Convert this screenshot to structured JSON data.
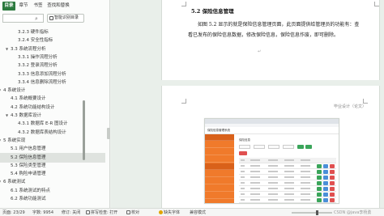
{
  "nav": {
    "tabs": [
      {
        "label": "目录",
        "active": true
      },
      {
        "label": "章节",
        "active": false
      },
      {
        "label": "书签",
        "active": false
      },
      {
        "label": "查找和替换",
        "active": false
      }
    ],
    "search_placeholder": "",
    "smart_toc_label": "智能识别目录",
    "toc": [
      {
        "label": "3.2.3 硬件指标",
        "level": 3,
        "expanded": null,
        "selected": false
      },
      {
        "label": "3.2.4 安全性指标",
        "level": 3,
        "expanded": null,
        "selected": false
      },
      {
        "label": "3.3 系统流程分析",
        "level": 2,
        "expanded": true,
        "selected": false
      },
      {
        "label": "3.3.1 操作流程分析",
        "level": 3,
        "expanded": null,
        "selected": false
      },
      {
        "label": "3.3.2 登录流程分析",
        "level": 3,
        "expanded": null,
        "selected": false
      },
      {
        "label": "3.3.3 信息添加流程分析",
        "level": 3,
        "expanded": null,
        "selected": false
      },
      {
        "label": "3.3.4 信息删除流程分析",
        "level": 3,
        "expanded": null,
        "selected": false
      },
      {
        "label": "4 系统设计",
        "level": 1,
        "expanded": true,
        "selected": false
      },
      {
        "label": "4.1 系统概要设计",
        "level": 2,
        "expanded": null,
        "selected": false
      },
      {
        "label": "4.2 系统功能结构设计",
        "level": 2,
        "expanded": null,
        "selected": false
      },
      {
        "label": "4.3 数据库设计",
        "level": 2,
        "expanded": true,
        "selected": false
      },
      {
        "label": "4.3.1 数据库 E-R 图设计",
        "level": 3,
        "expanded": null,
        "selected": false
      },
      {
        "label": "4.3.2 数据库表结构设计",
        "level": 3,
        "expanded": null,
        "selected": false
      },
      {
        "label": "5 系统实现",
        "level": 1,
        "expanded": true,
        "selected": false
      },
      {
        "label": "5.1 用户信息管理",
        "level": 2,
        "expanded": null,
        "selected": false
      },
      {
        "label": "5.2 保险信息管理",
        "level": 2,
        "expanded": null,
        "selected": true
      },
      {
        "label": "5.3 保险类型管理",
        "level": 2,
        "expanded": null,
        "selected": false
      },
      {
        "label": "5.4 购险申请管理",
        "level": 2,
        "expanded": null,
        "selected": false
      },
      {
        "label": "6 系统测试",
        "level": 1,
        "expanded": true,
        "selected": false
      },
      {
        "label": "6.1 系统测试的特点",
        "level": 2,
        "expanded": null,
        "selected": false
      },
      {
        "label": "6.2 系统功能测试",
        "level": 2,
        "expanded": null,
        "selected": false
      }
    ]
  },
  "document": {
    "section_heading": "5.2 保险信息管理",
    "paragraph_lines": [
      "如图 5.2 显示的就是保险信息管理页面，此页面提供给管理员的功能有：查",
      "看已发布的保险信息数据，修改保险信息，保险信息作废，即可删除。"
    ],
    "footer_label": "毕业设计（论文）",
    "figure": {
      "title": "保险信息管理系统",
      "heading": "保险信息",
      "table_rows": 7
    }
  },
  "statusbar": {
    "page": "页面: 23/29",
    "words": "字数: 9954",
    "revision": "修订: 关闭",
    "spellcheck": "拼写检查: 打开",
    "proofread": "校对",
    "missing_font": "缺失字体",
    "compat_mode": "兼容模式",
    "zoom_fraction": 0.62,
    "watermark": "CSDN @java李杨勇"
  },
  "colors": {
    "tab_active": "#2c7a3f",
    "figure_sidebar": "#f07a2b",
    "figure_add_button": "#e05050",
    "figure_green_button": "#3aa55a"
  }
}
